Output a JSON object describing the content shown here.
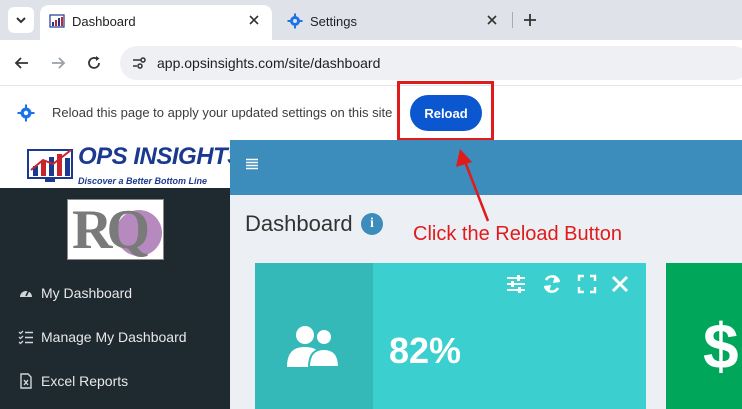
{
  "browser": {
    "tabs": [
      {
        "title": "Dashboard",
        "active": true
      },
      {
        "title": "Settings",
        "active": false
      }
    ],
    "url": "app.opsinsights.com/site/dashboard"
  },
  "infobar": {
    "message": "Reload this page to apply your updated settings on this site",
    "button_label": "Reload"
  },
  "logo": {
    "title": "OPS INSIGHTS",
    "tagline": "Discover a Better Bottom Line",
    "company_mark": "RQ"
  },
  "sidebar": {
    "items": [
      {
        "label": "My Dashboard",
        "icon": "speedometer-icon"
      },
      {
        "label": "Manage My Dashboard",
        "icon": "list-check-icon"
      },
      {
        "label": "Excel Reports",
        "icon": "excel-file-icon"
      }
    ]
  },
  "main": {
    "title": "Dashboard",
    "info_glyph": "i"
  },
  "widgets": [
    {
      "value": "82%",
      "icon": "users-icon",
      "color": "#3ccfcf"
    },
    {
      "glyph": "$",
      "color": "#00a65a"
    }
  ],
  "annotation": {
    "text": "Click the Reload Button",
    "color": "#e01b1b"
  },
  "colors": {
    "reload_button": "#0b57d0",
    "topbar": "#3c8dbc",
    "sidebar": "#1f2a30"
  }
}
